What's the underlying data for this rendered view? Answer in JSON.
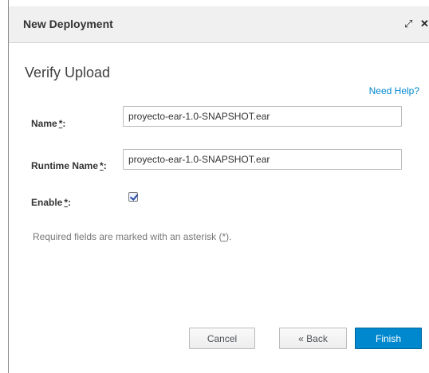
{
  "dialog": {
    "title": "New Deployment",
    "maximize_icon": "maximize-icon",
    "close_icon": "close-icon"
  },
  "form": {
    "heading": "Verify Upload",
    "help_link": "Need Help?",
    "name_label": "Name",
    "name_value": "proyecto-ear-1.0-SNAPSHOT.ear",
    "runtime_label": "Runtime Name",
    "runtime_value": "proyecto-ear-1.0-SNAPSHOT.ear",
    "enable_label": "Enable",
    "enable_checked": true,
    "required_marker": "*",
    "colon": ":",
    "note_prefix": "Required fields are marked with an asterisk (",
    "note_suffix": ")."
  },
  "buttons": {
    "cancel": "Cancel",
    "back": "« Back",
    "finish": "Finish"
  },
  "colors": {
    "primary": "#0088ce",
    "link": "#0088ce"
  }
}
